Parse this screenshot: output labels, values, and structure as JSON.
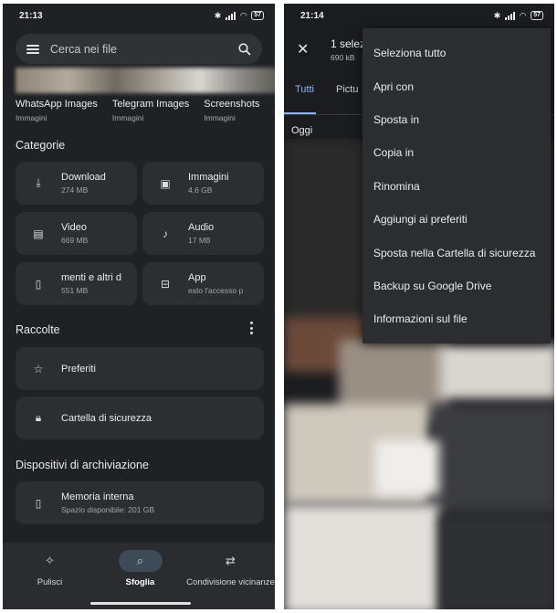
{
  "left_screen": {
    "status": {
      "time": "21:13",
      "battery": "57"
    },
    "search": {
      "placeholder": "Cerca nei file"
    },
    "folders": [
      {
        "name": "WhatsApp Images",
        "type": "Immagini"
      },
      {
        "name": "Telegram Images",
        "type": "Immagini"
      },
      {
        "name": "Screenshots",
        "type": "Immagini"
      }
    ],
    "categories": {
      "title": "Categorie",
      "items": [
        {
          "label": "Download",
          "size": "274 MB",
          "icon": "download-icon"
        },
        {
          "label": "Immagini",
          "size": "4,6 GB",
          "icon": "image-icon"
        },
        {
          "label": "Video",
          "size": "669 MB",
          "icon": "video-icon"
        },
        {
          "label": "Audio",
          "size": "17 MB",
          "icon": "music-note-icon"
        },
        {
          "label": "menti e altri d",
          "size": "551 MB",
          "icon": "document-icon"
        },
        {
          "label": "App",
          "size": "esto l'accesso p",
          "icon": "app-icon"
        }
      ]
    },
    "collections": {
      "title": "Raccolte",
      "items": [
        {
          "label": "Preferiti",
          "icon": "star-icon"
        },
        {
          "label": "Cartella di sicurezza",
          "icon": "lock-icon"
        }
      ]
    },
    "storage": {
      "title": "Dispositivi di archiviazione",
      "items": [
        {
          "label": "Memoria interna",
          "detail": "Spazio disponibile: 201 GB",
          "icon": "phone-icon"
        }
      ]
    },
    "bottom_nav": [
      {
        "label": "Pulisci",
        "icon": "sparkle-icon",
        "active": false
      },
      {
        "label": "Sfoglia",
        "icon": "browse-icon",
        "active": true
      },
      {
        "label": "Condivisione vicinanze",
        "icon": "nearby-share-icon",
        "active": false
      }
    ]
  },
  "right_screen": {
    "status": {
      "time": "21:14",
      "battery": "57"
    },
    "selection": {
      "title": "1 selez",
      "size": "690 kB"
    },
    "tabs": [
      "Tutti",
      "Pictu"
    ],
    "date_header": "Oggi",
    "menu": [
      "Seleziona tutto",
      "Apri con",
      "Sposta in",
      "Copia in",
      "Rinomina",
      "Aggiungi ai preferiti",
      "Sposta nella Cartella di sicurezza",
      "Backup su Google Drive",
      "Informazioni sul file"
    ]
  },
  "colors": {
    "background": "#1f2125",
    "card": "#2c2e32",
    "accent": "#8ab4f8",
    "menu": "#2c2d31"
  }
}
